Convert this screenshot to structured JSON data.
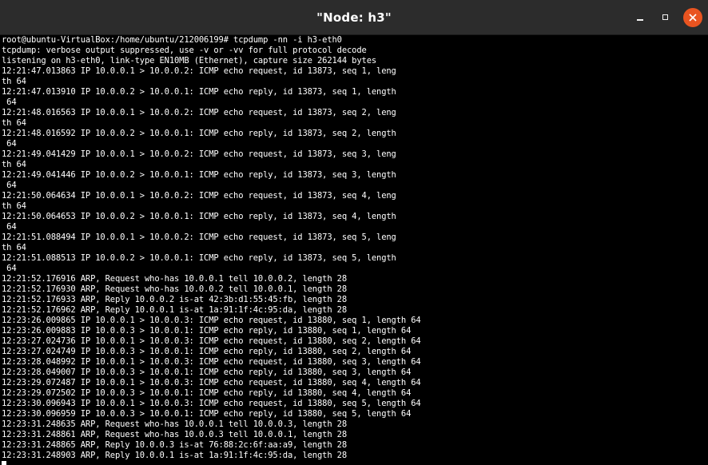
{
  "window": {
    "title": "\"Node: h3\"",
    "controls": [
      "minimize-icon",
      "maximize-icon",
      "close-icon"
    ],
    "colors": {
      "titlebar": "#2c2c2c",
      "title_text": "#ffffff",
      "close_button": "#e95420",
      "terminal_bg": "#000000",
      "terminal_fg": "#ffffff"
    }
  },
  "terminal": {
    "lines": [
      "root@ubuntu-VirtualBox:/home/ubuntu/212006199# tcpdump -nn -i h3-eth0",
      "tcpdump: verbose output suppressed, use -v or -vv for full protocol decode",
      "listening on h3-eth0, link-type EN10MB (Ethernet), capture size 262144 bytes",
      "12:21:47.013863 IP 10.0.0.1 > 10.0.0.2: ICMP echo request, id 13873, seq 1, leng",
      "th 64",
      "12:21:47.013910 IP 10.0.0.2 > 10.0.0.1: ICMP echo reply, id 13873, seq 1, length",
      " 64",
      "12:21:48.016563 IP 10.0.0.1 > 10.0.0.2: ICMP echo request, id 13873, seq 2, leng",
      "th 64",
      "12:21:48.016592 IP 10.0.0.2 > 10.0.0.1: ICMP echo reply, id 13873, seq 2, length",
      " 64",
      "12:21:49.041429 IP 10.0.0.1 > 10.0.0.2: ICMP echo request, id 13873, seq 3, leng",
      "th 64",
      "12:21:49.041446 IP 10.0.0.2 > 10.0.0.1: ICMP echo reply, id 13873, seq 3, length",
      " 64",
      "12:21:50.064634 IP 10.0.0.1 > 10.0.0.2: ICMP echo request, id 13873, seq 4, leng",
      "th 64",
      "12:21:50.064653 IP 10.0.0.2 > 10.0.0.1: ICMP echo reply, id 13873, seq 4, length",
      " 64",
      "12:21:51.088494 IP 10.0.0.1 > 10.0.0.2: ICMP echo request, id 13873, seq 5, leng",
      "th 64",
      "12:21:51.088513 IP 10.0.0.2 > 10.0.0.1: ICMP echo reply, id 13873, seq 5, length",
      " 64",
      "12:21:52.176916 ARP, Request who-has 10.0.0.1 tell 10.0.0.2, length 28",
      "12:21:52.176930 ARP, Request who-has 10.0.0.2 tell 10.0.0.1, length 28",
      "12:21:52.176933 ARP, Reply 10.0.0.2 is-at 42:3b:d1:55:45:fb, length 28",
      "12:21:52.176962 ARP, Reply 10.0.0.1 is-at 1a:91:1f:4c:95:da, length 28",
      "12:23:26.009865 IP 10.0.0.1 > 10.0.0.3: ICMP echo request, id 13880, seq 1, length 64",
      "12:23:26.009883 IP 10.0.0.3 > 10.0.0.1: ICMP echo reply, id 13880, seq 1, length 64",
      "12:23:27.024736 IP 10.0.0.1 > 10.0.0.3: ICMP echo request, id 13880, seq 2, length 64",
      "12:23:27.024749 IP 10.0.0.3 > 10.0.0.1: ICMP echo reply, id 13880, seq 2, length 64",
      "12:23:28.048992 IP 10.0.0.1 > 10.0.0.3: ICMP echo request, id 13880, seq 3, length 64",
      "12:23:28.049007 IP 10.0.0.3 > 10.0.0.1: ICMP echo reply, id 13880, seq 3, length 64",
      "12:23:29.072487 IP 10.0.0.1 > 10.0.0.3: ICMP echo request, id 13880, seq 4, length 64",
      "12:23:29.072502 IP 10.0.0.3 > 10.0.0.1: ICMP echo reply, id 13880, seq 4, length 64",
      "12:23:30.096943 IP 10.0.0.1 > 10.0.0.3: ICMP echo request, id 13880, seq 5, length 64",
      "12:23:30.096959 IP 10.0.0.3 > 10.0.0.1: ICMP echo reply, id 13880, seq 5, length 64",
      "12:23:31.248635 ARP, Request who-has 10.0.0.1 tell 10.0.0.3, length 28",
      "12:23:31.248861 ARP, Request who-has 10.0.0.3 tell 10.0.0.1, length 28",
      "12:23:31.248865 ARP, Reply 10.0.0.3 is-at 76:88:2c:6f:aa:a9, length 28",
      "12:23:31.248903 ARP, Reply 10.0.0.1 is-at 1a:91:1f:4c:95:da, length 28"
    ]
  }
}
